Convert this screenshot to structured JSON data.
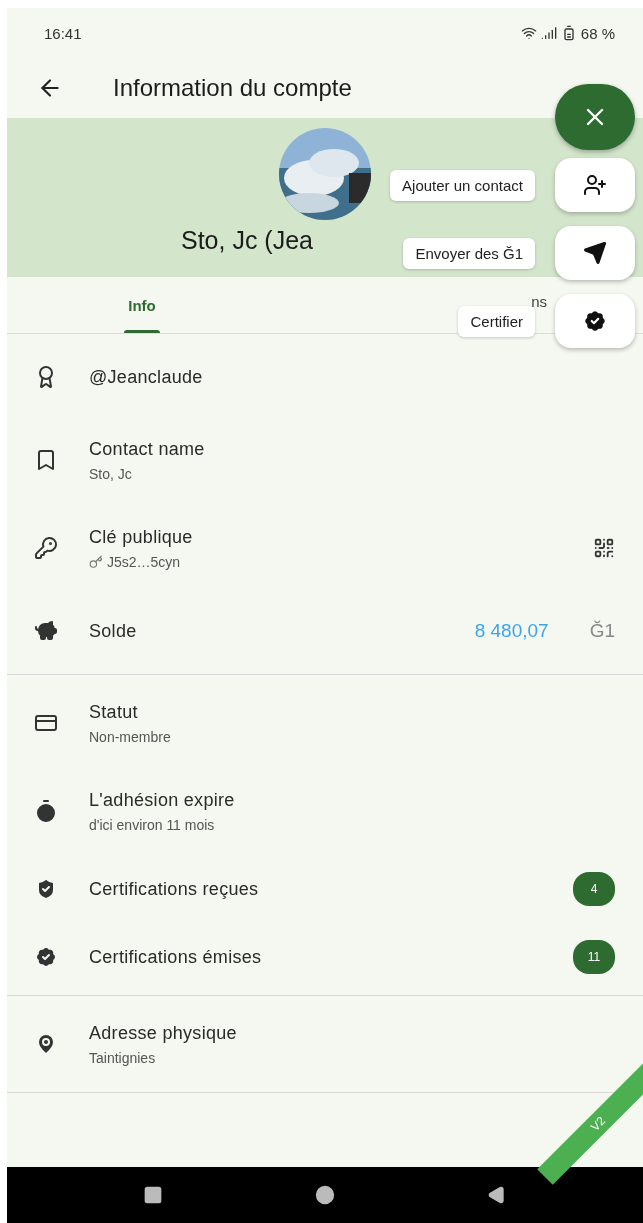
{
  "status_bar": {
    "time": "16:41",
    "battery": "68 %"
  },
  "app_bar": {
    "title": "Information du compte"
  },
  "header": {
    "name": "Sto, Jc (Jea"
  },
  "tabs": [
    {
      "label": "Info",
      "selected": true
    },
    {
      "label": "ns",
      "selected": false
    }
  ],
  "sections": [
    [
      {
        "kind": "plain",
        "title": "@Jeanclaude"
      },
      {
        "kind": "two_line",
        "title": "Contact name",
        "subtitle": "Sto, Jc"
      },
      {
        "kind": "key",
        "title": "Clé publique",
        "subtitle": "J5s2…5cyn"
      },
      {
        "kind": "balance",
        "title": "Solde",
        "amount": "8 480,07",
        "unit": "Ğ1"
      }
    ],
    [
      {
        "kind": "two_line",
        "title": "Statut",
        "subtitle": "Non-membre"
      },
      {
        "kind": "two_line",
        "title": "L'adhésion expire",
        "subtitle": "d'ici environ 11 mois"
      },
      {
        "kind": "count",
        "title": "Certifications reçues",
        "count": "4"
      },
      {
        "kind": "count",
        "title": "Certifications émises",
        "count": "11"
      }
    ],
    [
      {
        "kind": "two_line",
        "title": "Adresse physique",
        "subtitle": "Taintignies"
      }
    ]
  ],
  "speed_dial": {
    "actions": [
      {
        "label": "Ajouter un contact"
      },
      {
        "label": "Envoyer des Ğ1"
      },
      {
        "label": "Certifier"
      }
    ]
  },
  "ribbon": "V2"
}
